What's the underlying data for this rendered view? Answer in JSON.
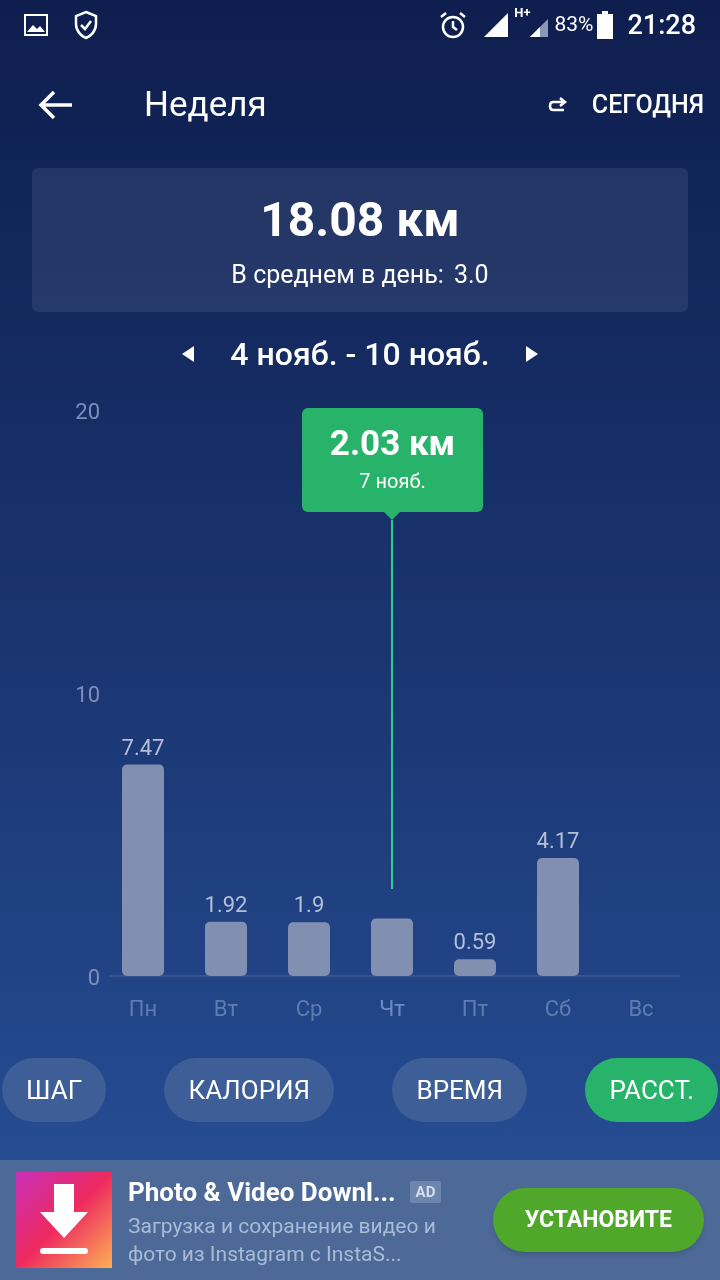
{
  "status_bar": {
    "network_type": "H+",
    "battery": "83%",
    "time": "21:28"
  },
  "header": {
    "title": "Неделя",
    "today_button": "СЕГОДНЯ"
  },
  "summary": {
    "total": "18.08 км",
    "average_label": "В среднем в день:",
    "average_value": "3.0"
  },
  "period": {
    "label": "4 нояб. - 10 нояб."
  },
  "chart": {
    "highlight": [
      false,
      false,
      false,
      true,
      false,
      false,
      false
    ],
    "tooltip": {
      "value": "2.03 км",
      "date": "7 нояб."
    },
    "chart_data": {
      "type": "bar",
      "categories": [
        "Пн",
        "Вт",
        "Ср",
        "Чт",
        "Пт",
        "Сб",
        "Вс"
      ],
      "values": [
        7.47,
        1.92,
        1.9,
        2.03,
        0.59,
        4.17,
        null
      ],
      "ylim": [
        0,
        20
      ],
      "yticks": [
        0,
        10,
        20
      ],
      "value_labels": [
        "7.47",
        "1.92",
        "1.9",
        null,
        "0.59",
        "4.17",
        null
      ]
    }
  },
  "modes": [
    {
      "label": "ШАГ",
      "selected": false
    },
    {
      "label": "КАЛОРИЯ",
      "selected": false
    },
    {
      "label": "ВРЕМЯ",
      "selected": false
    },
    {
      "label": "РАССТ.",
      "selected": true
    }
  ],
  "ad": {
    "title": "Photo & Video Downl...",
    "badge": "AD",
    "description": "Загрузка и сохранение видео и фото из Instagram с InstaS...",
    "button": "УСТАНОВИТЕ"
  }
}
